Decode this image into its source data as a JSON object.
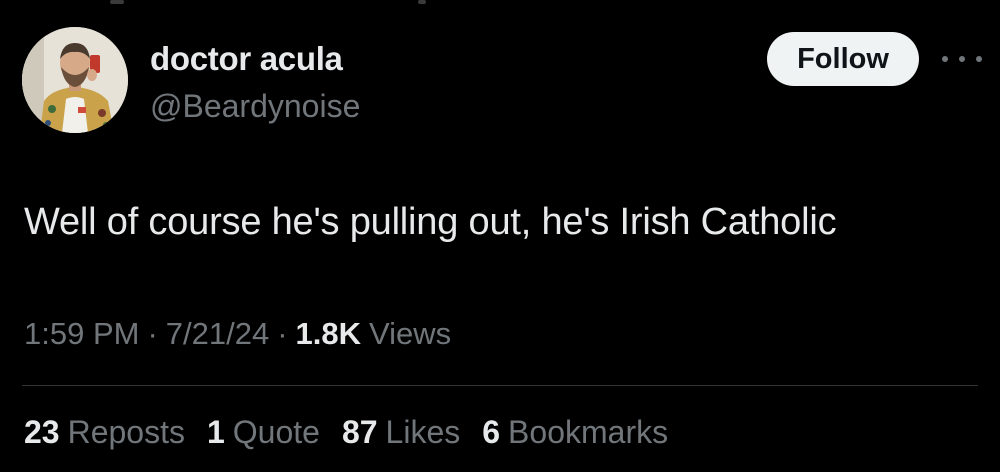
{
  "user": {
    "display_name": "doctor acula",
    "handle": "@Beardynoise"
  },
  "actions": {
    "follow_label": "Follow",
    "more_icon": "more-horizontal-icon"
  },
  "tweet": {
    "text": "Well of course he's pulling out, he's Irish Catholic"
  },
  "meta": {
    "time": "1:59 PM",
    "separator": "·",
    "date": "7/21/24",
    "views_count": "1.8K",
    "views_label": "Views"
  },
  "stats": [
    {
      "count": "23",
      "label": "Reposts"
    },
    {
      "count": "1",
      "label": "Quote"
    },
    {
      "count": "87",
      "label": "Likes"
    },
    {
      "count": "6",
      "label": "Bookmarks"
    }
  ],
  "colors": {
    "background": "#000000",
    "primary_text": "#e7e9ea",
    "secondary_text": "#71767b",
    "divider": "#2f3336",
    "follow_button_bg": "#eff3f4",
    "follow_button_text": "#0f1419"
  }
}
